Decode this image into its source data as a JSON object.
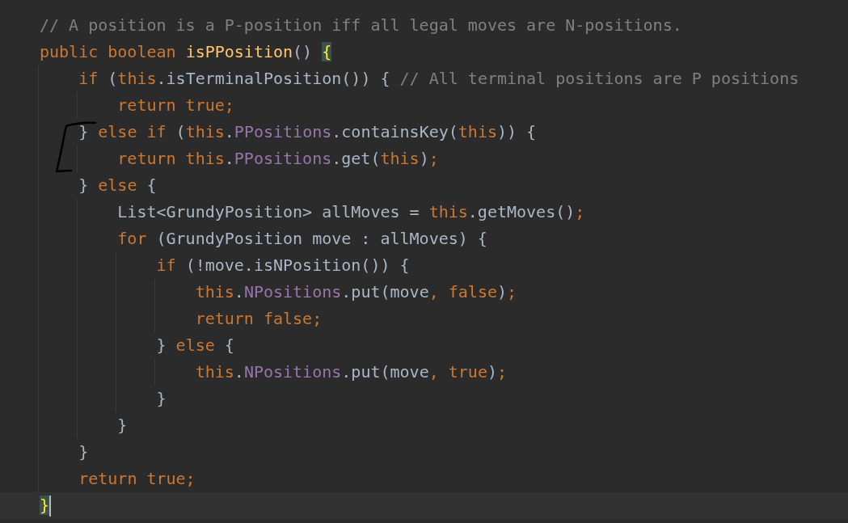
{
  "editor": {
    "lines": [
      {
        "current": false,
        "tokens": [
          {
            "text": "// A position is a P-position iff all legal moves are N-positions.",
            "kind": "comment"
          }
        ]
      },
      {
        "current": false,
        "tokens": [
          {
            "text": "public boolean ",
            "kind": "keyword"
          },
          {
            "text": "isPPosition",
            "kind": "method"
          },
          {
            "text": "() ",
            "kind": "plain"
          },
          {
            "text": "{",
            "kind": "matched-brace"
          }
        ]
      },
      {
        "current": false,
        "tokens": [
          {
            "text": "    if ",
            "kind": "keyword"
          },
          {
            "text": "(",
            "kind": "plain"
          },
          {
            "text": "this",
            "kind": "keyword"
          },
          {
            "text": ".isTerminalPosition()) { ",
            "kind": "plain"
          },
          {
            "text": "// All terminal positions are P positions",
            "kind": "comment"
          }
        ]
      },
      {
        "current": false,
        "tokens": [
          {
            "text": "        return true;",
            "kind": "keyword"
          }
        ]
      },
      {
        "current": false,
        "tokens": [
          {
            "text": "    } ",
            "kind": "plain"
          },
          {
            "text": "else if ",
            "kind": "keyword"
          },
          {
            "text": "(",
            "kind": "plain"
          },
          {
            "text": "this",
            "kind": "keyword"
          },
          {
            "text": ".",
            "kind": "plain"
          },
          {
            "text": "PPositions",
            "kind": "field"
          },
          {
            "text": ".containsKey(",
            "kind": "plain"
          },
          {
            "text": "this",
            "kind": "keyword"
          },
          {
            "text": ")) {",
            "kind": "plain"
          }
        ]
      },
      {
        "current": false,
        "tokens": [
          {
            "text": "        return this",
            "kind": "keyword"
          },
          {
            "text": ".",
            "kind": "plain"
          },
          {
            "text": "PPositions",
            "kind": "field"
          },
          {
            "text": ".get(",
            "kind": "plain"
          },
          {
            "text": "this",
            "kind": "keyword"
          },
          {
            "text": ")",
            "kind": "plain"
          },
          {
            "text": ";",
            "kind": "keyword"
          }
        ]
      },
      {
        "current": false,
        "tokens": [
          {
            "text": "    } ",
            "kind": "plain"
          },
          {
            "text": "else",
            "kind": "keyword"
          },
          {
            "text": " {",
            "kind": "plain"
          }
        ]
      },
      {
        "current": false,
        "tokens": [
          {
            "text": "        List<GrundyPosition> allMoves = ",
            "kind": "plain"
          },
          {
            "text": "this",
            "kind": "keyword"
          },
          {
            "text": ".getMoves()",
            "kind": "plain"
          },
          {
            "text": ";",
            "kind": "keyword"
          }
        ]
      },
      {
        "current": false,
        "tokens": [
          {
            "text": "        for ",
            "kind": "keyword"
          },
          {
            "text": "(GrundyPosition move : allMoves) {",
            "kind": "plain"
          }
        ]
      },
      {
        "current": false,
        "tokens": [
          {
            "text": "            if ",
            "kind": "keyword"
          },
          {
            "text": "(!move.isNPosition()) {",
            "kind": "plain"
          }
        ]
      },
      {
        "current": false,
        "tokens": [
          {
            "text": "                this",
            "kind": "keyword"
          },
          {
            "text": ".",
            "kind": "plain"
          },
          {
            "text": "NPositions",
            "kind": "field"
          },
          {
            "text": ".put(move",
            "kind": "plain"
          },
          {
            "text": ", false",
            "kind": "keyword"
          },
          {
            "text": ")",
            "kind": "plain"
          },
          {
            "text": ";",
            "kind": "keyword"
          }
        ]
      },
      {
        "current": false,
        "tokens": [
          {
            "text": "                return false;",
            "kind": "keyword"
          }
        ]
      },
      {
        "current": false,
        "tokens": [
          {
            "text": "            } ",
            "kind": "plain"
          },
          {
            "text": "else",
            "kind": "keyword"
          },
          {
            "text": " {",
            "kind": "plain"
          }
        ]
      },
      {
        "current": false,
        "tokens": [
          {
            "text": "                this",
            "kind": "keyword"
          },
          {
            "text": ".",
            "kind": "plain"
          },
          {
            "text": "NPositions",
            "kind": "field"
          },
          {
            "text": ".put(move",
            "kind": "plain"
          },
          {
            "text": ", true",
            "kind": "keyword"
          },
          {
            "text": ")",
            "kind": "plain"
          },
          {
            "text": ";",
            "kind": "keyword"
          }
        ]
      },
      {
        "current": false,
        "tokens": [
          {
            "text": "            }",
            "kind": "plain"
          }
        ]
      },
      {
        "current": false,
        "tokens": [
          {
            "text": "        }",
            "kind": "plain"
          }
        ]
      },
      {
        "current": false,
        "tokens": [
          {
            "text": "    }",
            "kind": "plain"
          }
        ]
      },
      {
        "current": false,
        "tokens": [
          {
            "text": "    return true;",
            "kind": "keyword"
          }
        ]
      },
      {
        "current": true,
        "tokens": [
          {
            "text": "}",
            "kind": "matched-brace"
          }
        ]
      }
    ]
  }
}
